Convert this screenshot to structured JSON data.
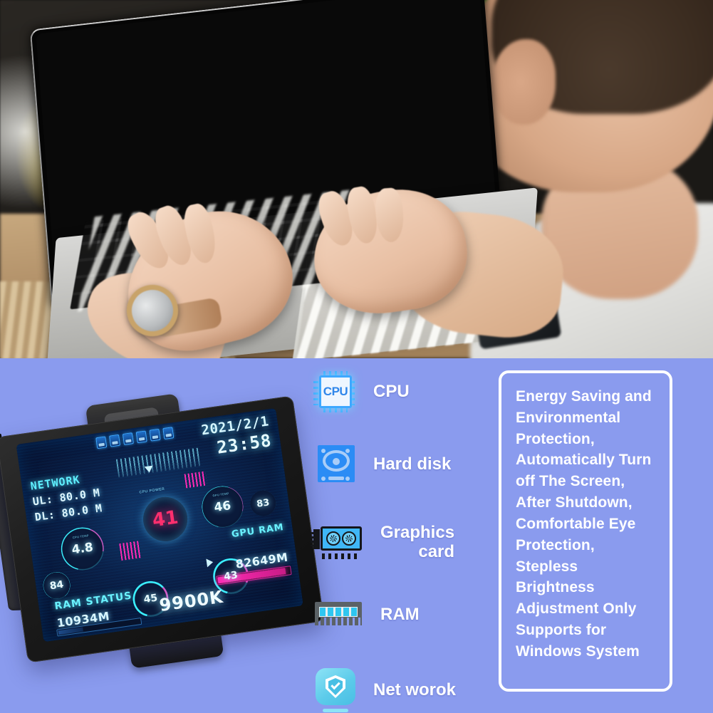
{
  "photo": {
    "scene_description": "Man working at laptop on wooden desk, hands on keyboard, plant and window in background"
  },
  "device": {
    "screen": {
      "date": "2021/2/1",
      "time": "23:58",
      "network": {
        "title": "NETWORK",
        "upload_label": "UL:",
        "upload_value": "80.0 M",
        "download_label": "DL:",
        "download_value": "80.0 M"
      },
      "cpu_hub": {
        "value": "41",
        "caption": "CPU POWER"
      },
      "cpu_model": "9900K",
      "gauges": [
        {
          "name": "cpu-temp",
          "value": "4.8",
          "caption": "CPU TEMP"
        },
        {
          "name": "cpu-load",
          "value": "84",
          "caption": ""
        },
        {
          "name": "ram-load",
          "value": "45",
          "caption": ""
        },
        {
          "name": "gpu-temp",
          "value": "46",
          "caption": "GPU TEMP"
        },
        {
          "name": "gpu-fan",
          "value": "83",
          "caption": ""
        },
        {
          "name": "gpu-load",
          "value": "43",
          "caption": ""
        }
      ],
      "ram_status": {
        "label": "RAM STATUS",
        "value": "10934M"
      },
      "gpu_ram": {
        "label": "GPU RAM",
        "value": "82649M"
      },
      "status_icons_count": 6
    }
  },
  "features": [
    {
      "icon": "cpu-icon",
      "label": "CPU"
    },
    {
      "icon": "hard-disk-icon",
      "label": "Hard disk"
    },
    {
      "icon": "graphics-card-icon",
      "label": "Graphics\ncard"
    },
    {
      "icon": "ram-icon",
      "label": "RAM"
    },
    {
      "icon": "network-shield-icon",
      "label": "Net worok"
    }
  ],
  "info_box": {
    "text": "Energy Saving and Environmental Protection, Automatically Turn off The Screen, After Shutdown, Comfortable Eye Protection, Stepless Brightness Adjustment\nOnly Supports for Windows System"
  },
  "colors": {
    "panel_background": "#8a9bee",
    "accent_cyan": "#3cf0ff",
    "accent_magenta": "#ff2bb5",
    "icon_blue": "#2b8cf5",
    "white": "#ffffff"
  }
}
